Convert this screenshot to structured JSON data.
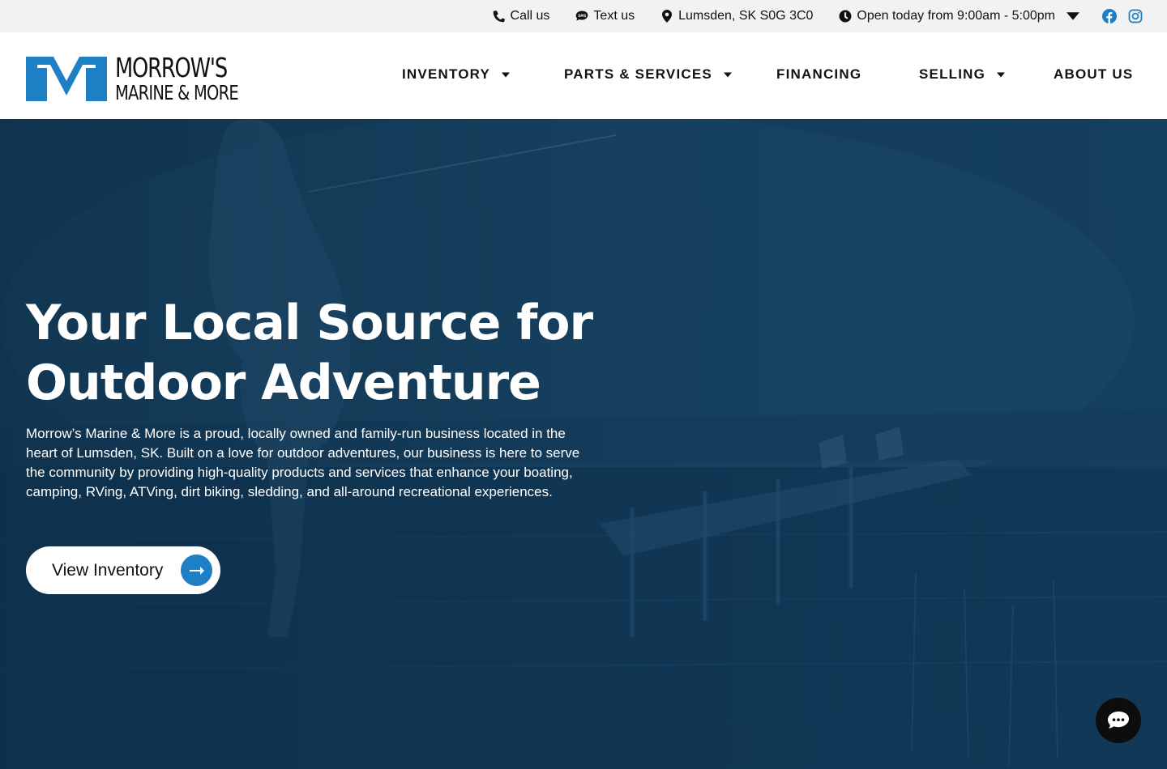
{
  "topbar": {
    "call_label": "Call us",
    "text_label": "Text us",
    "location": "Lumsden, SK S0G 3C0",
    "hours": "Open today from 9:00am - 5:00pm"
  },
  "brand": {
    "logo_line1": "MORROW'S",
    "logo_line2": "MARINE & MORE",
    "logo_color": "#1f7fc4"
  },
  "nav": {
    "inventory": "INVENTORY",
    "parts_services": "PARTS & SERVICES",
    "financing": "FINANCING",
    "selling": "SELLING",
    "about": "ABOUT US"
  },
  "hero": {
    "title_line1": "Your Local Source for",
    "title_line2": "Outdoor Adventure",
    "description": "Morrow’s Marine & More is a proud, locally owned and family-run business located in the heart of Lumsden, SK. Built on a love for outdoor adventures, our business is here to serve the community by providing high-quality products and services that enhance your boating, camping, RVing, ATVing, dirt biking, sledding, and all-around recreational experiences.",
    "cta_label": "View Inventory"
  },
  "colors": {
    "accent": "#1f7fc4",
    "hero_overlay": "#123a58",
    "topbar_bg": "#f2f2f2"
  },
  "icons": [
    "phone-icon",
    "sms-icon",
    "location-pin-icon",
    "clock-icon",
    "chevron-down-icon",
    "facebook-icon",
    "instagram-icon",
    "arrow-right-icon",
    "chat-icon"
  ]
}
